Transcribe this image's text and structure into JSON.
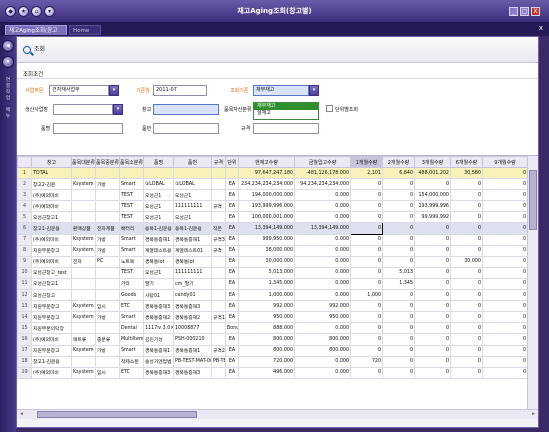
{
  "window": {
    "title": "재고Aging조회(창고별)",
    "controls": [
      "_",
      "□",
      "X"
    ]
  },
  "tabs": {
    "active": "재고Aging조회(창고별)",
    "active_close": "x",
    "home": "Home",
    "close_all": "x"
  },
  "toolbar": {
    "search_label": "조회"
  },
  "filter": {
    "header": "조회조건",
    "business_label": "사업부문",
    "business_value": "건자재사업부",
    "base_date_label": "기준월",
    "base_date_value": "2011-07",
    "criteria_label": "조회기준",
    "criteria_value": "재무재고",
    "criteria_options": [
      "재무재고",
      "실재고"
    ],
    "plant_label": "생산사업장",
    "warehouse_label": "창고",
    "item_type_label": "품목자산분류",
    "product_label": "품명",
    "item_label": "품번",
    "spec_label": "규격",
    "unit_check_label": "단위별조회"
  },
  "grid": {
    "columns": [
      "",
      "창고",
      "품목대분류",
      "품목중분류",
      "품목소분류",
      "품명",
      "품번",
      "규격",
      "단위",
      "현재고수량",
      "금월입고수량",
      "1개월수량",
      "2개월수량",
      "3개월수량",
      "6개월수량",
      "9개월수량"
    ],
    "rows": [
      [
        "1",
        "TOTAL",
        "",
        "",
        "",
        "",
        "",
        "",
        "",
        "97,647,247.180",
        "-481,126,178.000",
        "2,101",
        "6,840",
        "488,001,202",
        "30,580",
        "0"
      ],
      [
        "2",
        "창고2-김윤",
        "Ksystem",
        "가방",
        "Smart",
        "①LOBAL",
        "①LOBAL",
        "",
        "EA",
        "234,234,234,234.000",
        "94,234,234,234.000",
        "0",
        "0",
        "0",
        "0",
        "0"
      ],
      [
        "3",
        "(주)예외미비",
        "",
        "",
        "TEST",
        "오성근1",
        "오성근1",
        "",
        "EA",
        "194,000,000.000",
        "0.000",
        "0",
        "0",
        "154,000,000",
        "0",
        "0"
      ],
      [
        "4",
        "(주)예외미비",
        "",
        "",
        "TEST",
        "오성근1",
        "111111111",
        "규격",
        "EA",
        "193,999,996.000",
        "0.000",
        "0",
        "0",
        "193,999,996",
        "0",
        "0"
      ],
      [
        "5",
        "오성근창고1",
        "",
        "",
        "TEST",
        "오성근1",
        "오성근1",
        "",
        "EA",
        "100,000,001.000",
        "0.000",
        "0",
        "0",
        "99,999,992",
        "0",
        "0"
      ],
      [
        "6",
        "창고1-김윤용",
        "판매상품",
        "전자제품",
        "배터리",
        "용목1-김윤용",
        "용목1-김윤용",
        "작은",
        "EA",
        "13,394,149.000",
        "13,394,149.000",
        "0",
        "0",
        "0",
        "0",
        "0"
      ],
      [
        "7",
        "(주)예외미비",
        "Ksystem",
        "가방",
        "Smart",
        "경북통증재1",
        "경북통증재1",
        "규격3",
        "EA",
        "999,950.000",
        "0.000",
        "0",
        "0",
        "0",
        "0",
        "0"
      ],
      [
        "8",
        "지원부문창고",
        "Ksystem",
        "가방",
        "Smart",
        "계열테스트용",
        "계열테스트01",
        "규격",
        "EA",
        "38,000.000",
        "0.000",
        "0",
        "0",
        "0",
        "0",
        "0"
      ],
      [
        "9",
        "(주)예외미비",
        "전자",
        "PC",
        "노트북",
        "경북통lot",
        "경북통lot",
        "",
        "EA",
        "30,000.000",
        "0.000",
        "0",
        "0",
        "0",
        "30,000",
        "0"
      ],
      [
        "10",
        "오성근창고_test",
        "",
        "",
        "TEST",
        "오성근1",
        "111111111",
        "",
        "EA",
        "5,013.000",
        "0.000",
        "0",
        "5,013",
        "0",
        "0",
        "0"
      ],
      [
        "11",
        "오성근창고1",
        "",
        "",
        "기타",
        "딸기",
        "cm_딸기",
        "",
        "EA",
        "1,345.000",
        "0.000",
        "0",
        "1,345",
        "0",
        "0",
        "0"
      ],
      [
        "12",
        "오성근창고",
        "",
        "",
        "Goods",
        "사탕01",
        "candy01",
        "",
        "EA",
        "1,000.000",
        "0.000",
        "1,000",
        "0",
        "0",
        "0",
        "0"
      ],
      [
        "13",
        "지원부문창고",
        "Ksystem",
        "임시",
        "ETC",
        "경북통증재3",
        "경북통증재3",
        "",
        "EA",
        "992.000",
        "992.000",
        "0",
        "0",
        "0",
        "0",
        "0"
      ],
      [
        "14",
        "지원부문창고",
        "Ksystem",
        "가방",
        "Smart",
        "경북통증재2",
        "경북통증재2",
        "규격1",
        "EA",
        "950.000",
        "950.000",
        "0",
        "0",
        "0",
        "0",
        "0"
      ],
      [
        "15",
        "지원부문의탁장",
        "",
        "",
        "Dental",
        "1117ⅳ 3.0×",
        "10008877",
        "",
        "Bonus",
        "888.000",
        "0.000",
        "0",
        "0",
        "0",
        "0",
        "0"
      ],
      [
        "16",
        "(주)예외미비",
        "애트류",
        "중분류",
        "Multiltem",
        "김민기성",
        "PSH-000210",
        "",
        "EA",
        "800.000",
        "800.000",
        "0",
        "0",
        "0",
        "0",
        "0"
      ],
      [
        "17",
        "지원부문창고",
        "Ksystem",
        "가방",
        "Smart",
        "경북통증재1",
        "경북통증재1",
        "규격2",
        "EA",
        "800.000",
        "800.000",
        "0",
        "0",
        "0",
        "0",
        "0"
      ],
      [
        "18",
        "창고1-김윤용",
        "",
        "",
        "작제소분",
        "송성기엔컴법",
        "PB-TEST-MAT-00",
        "PB-TE",
        "EA",
        "720.000",
        "0.000",
        "720",
        "0",
        "0",
        "0",
        "0"
      ],
      [
        "19",
        "(주)예외미비",
        "Ksystem",
        "임시",
        "ETC",
        "경북통증재3",
        "경북통증재3",
        "",
        "EA",
        "496.000",
        "0.000",
        "0",
        "0",
        "0",
        "0",
        "0"
      ]
    ]
  },
  "side": {
    "labels": [
      "연",
      "결",
      "작",
      "업",
      "메",
      "뉴"
    ]
  },
  "colors": {
    "accent": "#4b3d98",
    "total_row": "#f8f2b8",
    "required_label": "#e86a10",
    "selected_option": "#2f8f2f"
  }
}
